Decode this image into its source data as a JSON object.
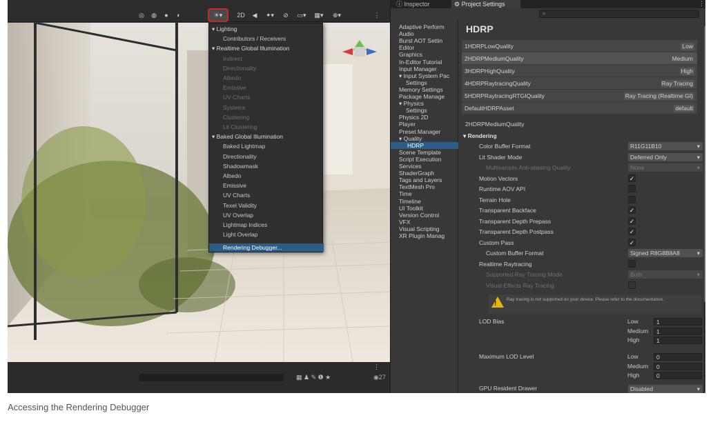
{
  "scene": {
    "toolbar_2d": "2D",
    "foot_count": "27"
  },
  "lighting_menu": {
    "items": [
      {
        "label": "▾ Lighting",
        "kind": "head"
      },
      {
        "label": "Contributors / Receivers",
        "kind": "item"
      },
      {
        "label": "▾ Realtime Global Illumination",
        "kind": "head"
      },
      {
        "label": "Indirect",
        "kind": "dim"
      },
      {
        "label": "Directionality",
        "kind": "dim"
      },
      {
        "label": "Albedo",
        "kind": "dim"
      },
      {
        "label": "Emissive",
        "kind": "dim"
      },
      {
        "label": "UV Charts",
        "kind": "dim"
      },
      {
        "label": "Systems",
        "kind": "dim"
      },
      {
        "label": "Clustering",
        "kind": "dim"
      },
      {
        "label": "Lit Clustering",
        "kind": "dim"
      },
      {
        "label": "▾ Baked Global Illumination",
        "kind": "head"
      },
      {
        "label": "Baked Lightmap",
        "kind": "item"
      },
      {
        "label": "Directionality",
        "kind": "item"
      },
      {
        "label": "Shadowmask",
        "kind": "item"
      },
      {
        "label": "Albedo",
        "kind": "item"
      },
      {
        "label": "Emissive",
        "kind": "item"
      },
      {
        "label": "UV Charts",
        "kind": "item"
      },
      {
        "label": "Texel Validity",
        "kind": "item"
      },
      {
        "label": "UV Overlap",
        "kind": "item"
      },
      {
        "label": "Lightmap Indices",
        "kind": "item"
      },
      {
        "label": "Light Overlap",
        "kind": "item"
      },
      {
        "label": "Rendering Debugger...",
        "kind": "sel"
      }
    ]
  },
  "tabs": {
    "inspector": "Inspector",
    "project_settings": "Project Settings"
  },
  "nav": [
    {
      "label": "Adaptive Perform",
      "kind": "top"
    },
    {
      "label": "Audio",
      "kind": "top"
    },
    {
      "label": "Burst AOT Settin",
      "kind": "top"
    },
    {
      "label": "Editor",
      "kind": "top"
    },
    {
      "label": "Graphics",
      "kind": "top"
    },
    {
      "label": "In-Editor Tutorial",
      "kind": "top"
    },
    {
      "label": "Input Manager",
      "kind": "top"
    },
    {
      "label": "▾ Input System Pac",
      "kind": "top"
    },
    {
      "label": "Settings",
      "kind": "sub"
    },
    {
      "label": "Memory Settings",
      "kind": "top"
    },
    {
      "label": "Package Manage",
      "kind": "top"
    },
    {
      "label": "▾ Physics",
      "kind": "top"
    },
    {
      "label": "Settings",
      "kind": "sub"
    },
    {
      "label": "Physics 2D",
      "kind": "top"
    },
    {
      "label": "Player",
      "kind": "top"
    },
    {
      "label": "Preset Manager",
      "kind": "top"
    },
    {
      "label": "▾ Quality",
      "kind": "top"
    },
    {
      "label": "HDRP",
      "kind": "sel"
    },
    {
      "label": "Scene Template",
      "kind": "top"
    },
    {
      "label": "Script Execution",
      "kind": "top"
    },
    {
      "label": "Services",
      "kind": "top"
    },
    {
      "label": "ShaderGraph",
      "kind": "top"
    },
    {
      "label": "Tags and Layers",
      "kind": "top"
    },
    {
      "label": "TextMesh Pro",
      "kind": "top"
    },
    {
      "label": "Time",
      "kind": "top"
    },
    {
      "label": "Timeline",
      "kind": "top"
    },
    {
      "label": "UI Toolkit",
      "kind": "top"
    },
    {
      "label": "Version Control",
      "kind": "top"
    },
    {
      "label": "VFX",
      "kind": "top"
    },
    {
      "label": "Visual Scripting",
      "kind": "top"
    },
    {
      "label": "XR Plugin Manag",
      "kind": "top"
    }
  ],
  "hdrp": {
    "title": "HDRP",
    "assets": [
      {
        "name": "1HDRPLowQuality",
        "value": "Low"
      },
      {
        "name": "2HDRPMediumQuality",
        "value": "Medium"
      },
      {
        "name": "3HDRPHighQuality",
        "value": "High"
      },
      {
        "name": "4HDRPRaytracingQuality",
        "value": "Ray Tracing"
      },
      {
        "name": "5HDRPRaytracingRTGIQuality",
        "value": "Ray Tracing (Realtime GI)"
      },
      {
        "name": "DefaultHDRPAsset",
        "value": "default"
      }
    ],
    "current_asset": "2HDRPMediumQuality",
    "section": "▾ Rendering",
    "settings": [
      {
        "label": "Color Buffer Format",
        "type": "dropdown",
        "value": "R11G11B10",
        "dim": false,
        "indent": 0
      },
      {
        "label": "Lit Shader Mode",
        "type": "dropdown",
        "value": "Deferred Only",
        "dim": false,
        "indent": 0
      },
      {
        "label": "Multisample Anti-aliasing Quality",
        "type": "dropdown",
        "value": "None",
        "dim": true,
        "indent": 1
      },
      {
        "label": "Motion Vectors",
        "type": "check",
        "value": "✓",
        "dim": false,
        "indent": 0
      },
      {
        "label": "Runtime AOV API",
        "type": "check",
        "value": "",
        "dim": false,
        "indent": 0
      },
      {
        "label": "Terrain Hole",
        "type": "check",
        "value": "",
        "dim": false,
        "indent": 0
      },
      {
        "label": "Transparent Backface",
        "type": "check",
        "value": "✓",
        "dim": false,
        "indent": 0
      },
      {
        "label": "Transparent Depth Prepass",
        "type": "check",
        "value": "✓",
        "dim": false,
        "indent": 0
      },
      {
        "label": "Transparent Depth Postpass",
        "type": "check",
        "value": "✓",
        "dim": false,
        "indent": 0
      },
      {
        "label": "Custom Pass",
        "type": "check",
        "value": "✓",
        "dim": false,
        "indent": 0
      },
      {
        "label": "Custom Buffer Format",
        "type": "dropdown",
        "value": "Signed R8G8B8A8",
        "dim": false,
        "indent": 1
      },
      {
        "label": "Realtime Raytracing",
        "type": "check",
        "value": "",
        "dim": false,
        "indent": 0
      },
      {
        "label": "Supported Ray Tracing Mode",
        "type": "dropdown",
        "value": "Both",
        "dim": true,
        "indent": 1
      },
      {
        "label": "Visual Effects Ray Tracing",
        "type": "check",
        "value": "",
        "dim": true,
        "indent": 1
      }
    ],
    "warning": "Ray tracing is not supported on your device. Please refer to the documentation.",
    "lod_bias": {
      "label": "LOD Bias",
      "rows": [
        {
          "k": "Low",
          "v": "1"
        },
        {
          "k": "Medium",
          "v": "1"
        },
        {
          "k": "High",
          "v": "1"
        }
      ]
    },
    "max_lod": {
      "label": "Maximum LOD Level",
      "rows": [
        {
          "k": "Low",
          "v": "0"
        },
        {
          "k": "Medium",
          "v": "0"
        },
        {
          "k": "High",
          "v": "0"
        }
      ]
    },
    "gpu_drawer": {
      "label": "GPU Resident Drawer",
      "value": "Disabled"
    }
  },
  "caption": "Accessing the Rendering Debugger"
}
